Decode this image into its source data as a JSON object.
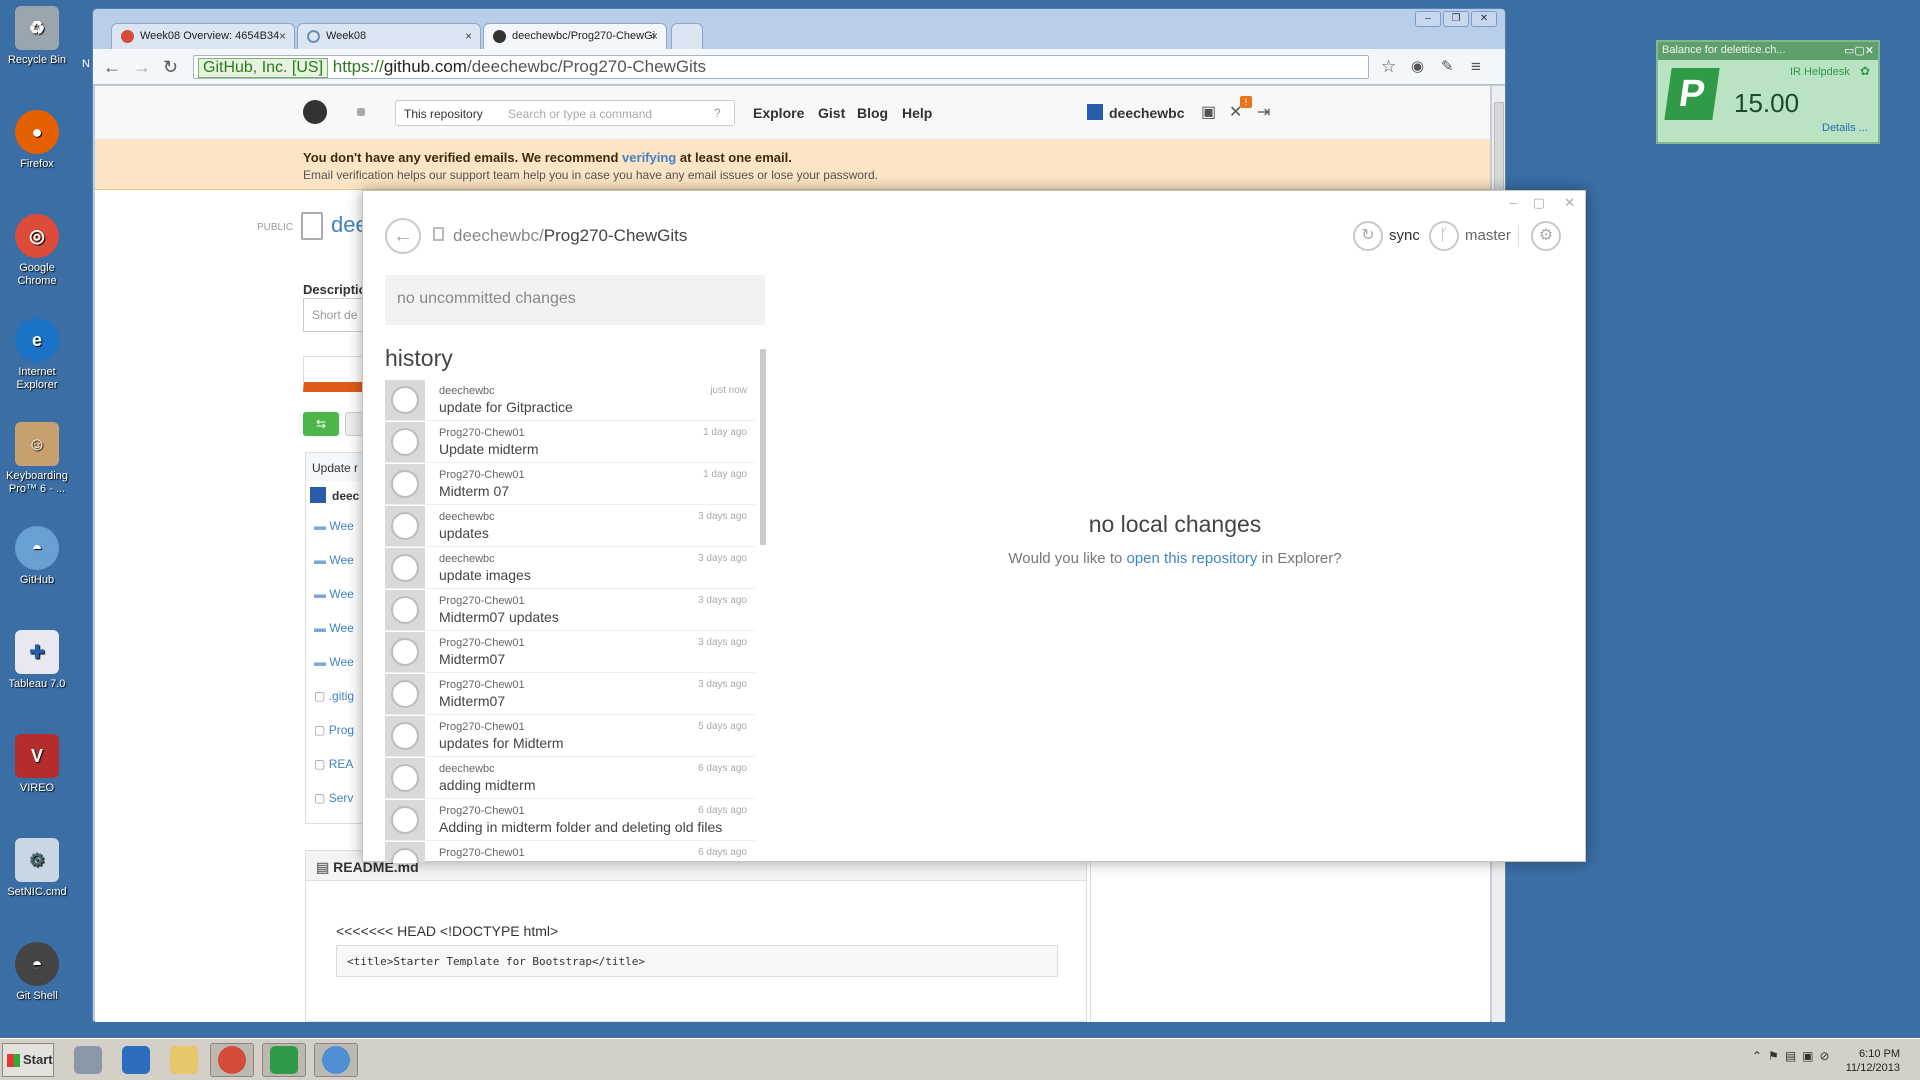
{
  "desktop": {
    "icons": [
      {
        "label": "Recycle Bin",
        "color": "#9aa5ad"
      },
      {
        "label": "Firefox",
        "color": "#e66000"
      },
      {
        "label": "Google Chrome",
        "color": "#dd4b39"
      },
      {
        "label": "Internet Explorer",
        "color": "#1a73c6"
      },
      {
        "label": "Keyboarding Pro™ 6 - ...",
        "color": "#c8a070"
      },
      {
        "label": "GitHub",
        "color": "#6a9fd4"
      },
      {
        "label": "Tableau 7.0",
        "color": "#e8e8f0"
      },
      {
        "label": "VIREO",
        "color": "#b52c2c"
      },
      {
        "label": "SetNIC.cmd",
        "color": "#c9d6e3"
      },
      {
        "label": "Git Shell",
        "color": "#444444"
      }
    ],
    "second_column_letter": "N"
  },
  "browser": {
    "tabs": [
      {
        "label": "Week08 Overview: 4654B34",
        "close": "×"
      },
      {
        "label": "Week08",
        "close": "×"
      },
      {
        "label": "deechewbc/Prog270-ChewGi",
        "close": "×"
      }
    ],
    "window_buttons": [
      "–",
      "❐",
      "✕"
    ],
    "nav": {
      "back": "←",
      "forward": "→",
      "reload": "↻"
    },
    "address": {
      "secure_label": "GitHub, Inc. [US]",
      "scheme": "https://",
      "host": "github.com",
      "path": "/deechewbc/Prog270-ChewGits"
    },
    "right_icons": [
      "☆",
      "◉",
      "✎",
      "≡"
    ]
  },
  "github": {
    "search_scope": "This repository",
    "search_placeholder": "Search or type a command",
    "nav": [
      "Explore",
      "Gist",
      "Blog",
      "Help"
    ],
    "username": "deechewbc",
    "notification_badge": "!",
    "banner": {
      "line1_prefix": "You don't have any verified emails. We recommend ",
      "line1_link": "verifying",
      "line1_suffix": " at least one email.",
      "line2": "Email verification helps our support team help you in case you have any email issues or lose your password."
    },
    "public_label": "PUBLIC",
    "repo_title_fragment": "dee",
    "description_label": "Descriptio",
    "description_placeholder": "Short de",
    "commit_header": "Update r",
    "commit_author": "deec",
    "files": [
      "Wee",
      "Wee",
      "Wee",
      "Wee",
      "Wee",
      ".gitig",
      "Prog",
      "REA",
      "Serv"
    ],
    "readme_title": "README.md",
    "readme_line": "<<<<<<< HEAD <!DOCTYPE html>",
    "readme_code": "<title>Starter Template for Bootstrap</title>"
  },
  "app": {
    "owner": "deechewbc/",
    "repo": "Prog270-ChewGits",
    "sync_label": "sync",
    "branch_label": "master",
    "uncommitted": "no uncommitted changes",
    "history_title": "history",
    "history": [
      {
        "author": "deechewbc",
        "message": "update for Gitpractice",
        "time": "just now"
      },
      {
        "author": "Prog270-Chew01",
        "message": "Update midterm",
        "time": "1 day ago"
      },
      {
        "author": "Prog270-Chew01",
        "message": "Midterm 07",
        "time": "1 day ago"
      },
      {
        "author": "deechewbc",
        "message": "updates",
        "time": "3 days ago"
      },
      {
        "author": "deechewbc",
        "message": "update images",
        "time": "3 days ago"
      },
      {
        "author": "Prog270-Chew01",
        "message": "Midterm07 updates",
        "time": "3 days ago"
      },
      {
        "author": "Prog270-Chew01",
        "message": "Midterm07",
        "time": "3 days ago"
      },
      {
        "author": "Prog270-Chew01",
        "message": "Midterm07",
        "time": "3 days ago"
      },
      {
        "author": "Prog270-Chew01",
        "message": "updates for Midterm",
        "time": "5 days ago"
      },
      {
        "author": "deechewbc",
        "message": "adding midterm",
        "time": "6 days ago"
      },
      {
        "author": "Prog270-Chew01",
        "message": "Adding in midterm folder and deleting old files",
        "time": "6 days ago"
      },
      {
        "author": "Prog270-Chew01",
        "message": "",
        "time": "6 days ago"
      }
    ],
    "empty_title": "no local changes",
    "empty_prefix": "Would you like to ",
    "empty_link": "open this repository",
    "empty_suffix": " in Explorer?"
  },
  "widget": {
    "title": "Balance for delettice.ch...",
    "helpdesk": "IR Helpdesk",
    "amount": "15.00",
    "details": "Details ..."
  },
  "taskbar": {
    "start": "Start",
    "apps": [
      {
        "name": "server-manager",
        "color": "#8a97a8"
      },
      {
        "name": "powershell",
        "color": "#2d6dbf"
      },
      {
        "name": "explorer",
        "color": "#e8c66a"
      },
      {
        "name": "chrome",
        "color": "#d64a3a"
      },
      {
        "name": "papercut",
        "color": "#2f9a47"
      },
      {
        "name": "github",
        "color": "#4d8fd0"
      }
    ],
    "time": "6:10 PM",
    "date": "11/12/2013"
  },
  "colors": {
    "link": "#4183c4",
    "banner_bg": "#fce4c5",
    "accent_orange": "#e05a1a",
    "green_btn": "#4cb648"
  }
}
